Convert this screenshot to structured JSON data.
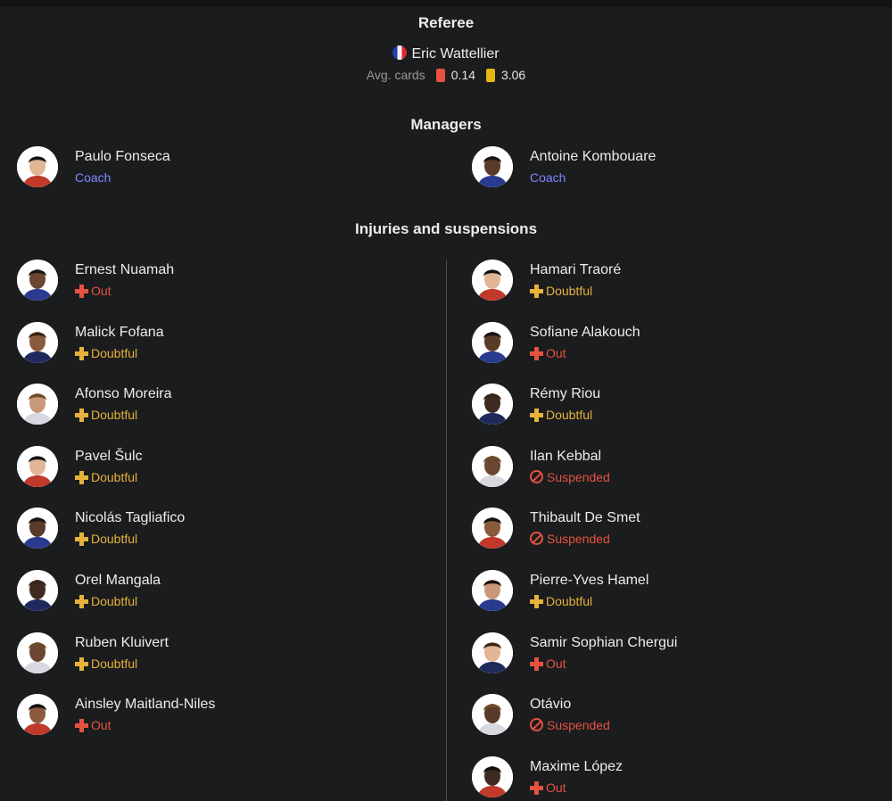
{
  "referee": {
    "title": "Referee",
    "name": "Eric Wattellier",
    "flag_icon": "france-flag-icon",
    "avg_cards_label": "Avg. cards",
    "red_cards": "0.14",
    "yellow_cards": "3.06",
    "red_color": "#e5523f",
    "yellow_color": "#e6b614"
  },
  "managers": {
    "title": "Managers",
    "home": {
      "name": "Paulo Fonseca",
      "role": "Coach"
    },
    "away": {
      "name": "Antoine Kombouare",
      "role": "Coach"
    }
  },
  "injuries": {
    "title": "Injuries and suspensions",
    "home": [
      {
        "name": "Ernest Nuamah",
        "status": "Out"
      },
      {
        "name": "Malick Fofana",
        "status": "Doubtful"
      },
      {
        "name": "Afonso Moreira",
        "status": "Doubtful"
      },
      {
        "name": "Pavel Šulc",
        "status": "Doubtful"
      },
      {
        "name": "Nicolás Tagliafico",
        "status": "Doubtful"
      },
      {
        "name": "Orel Mangala",
        "status": "Doubtful"
      },
      {
        "name": "Ruben Kluivert",
        "status": "Doubtful"
      },
      {
        "name": "Ainsley Maitland-Niles",
        "status": "Out"
      }
    ],
    "away": [
      {
        "name": "Hamari Traoré",
        "status": "Doubtful"
      },
      {
        "name": "Sofiane Alakouch",
        "status": "Out"
      },
      {
        "name": "Rémy Riou",
        "status": "Doubtful"
      },
      {
        "name": "Ilan Kebbal",
        "status": "Suspended"
      },
      {
        "name": "Thibault De Smet",
        "status": "Suspended"
      },
      {
        "name": "Pierre-Yves Hamel",
        "status": "Doubtful"
      },
      {
        "name": "Samir Sophian Chergui",
        "status": "Out"
      },
      {
        "name": "Otávio",
        "status": "Suspended"
      },
      {
        "name": "Maxime López",
        "status": "Out"
      }
    ]
  },
  "colors": {
    "background": "#1b1c1e",
    "coach_label": "#7d88ff",
    "out": "#e5523f",
    "doubtful": "#e6b23a",
    "suspended": "#e5523f",
    "divider": "#4a4b4e"
  }
}
